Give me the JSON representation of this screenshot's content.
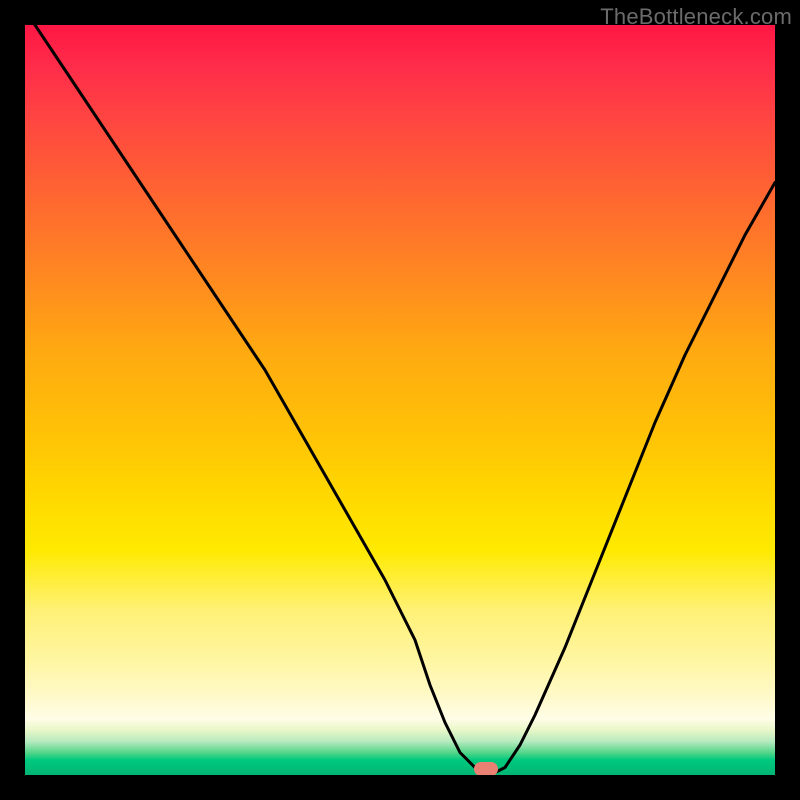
{
  "watermark": "TheBottleneck.com",
  "chart_data": {
    "type": "line",
    "title": "",
    "xlabel": "",
    "ylabel": "",
    "xlim": [
      0,
      100
    ],
    "ylim": [
      0,
      100
    ],
    "x": [
      0,
      4,
      8,
      12,
      16,
      20,
      24,
      28,
      32,
      36,
      40,
      44,
      48,
      52,
      54,
      56,
      58,
      60,
      61,
      62,
      64,
      66,
      68,
      72,
      76,
      80,
      84,
      88,
      92,
      96,
      100
    ],
    "values": [
      102,
      96,
      90,
      84,
      78,
      72,
      66,
      60,
      54,
      47,
      40,
      33,
      26,
      18,
      12,
      7,
      3,
      1,
      0,
      0,
      1,
      4,
      8,
      17,
      27,
      37,
      47,
      56,
      64,
      72,
      79
    ],
    "marker": {
      "x": 61.5,
      "y": 0
    },
    "gradient_stops": [
      {
        "pos": 0,
        "color": "#ff1744"
      },
      {
        "pos": 0.24,
        "color": "#ff6a2f"
      },
      {
        "pos": 0.54,
        "color": "#ffc107"
      },
      {
        "pos": 0.78,
        "color": "#fff176"
      },
      {
        "pos": 0.93,
        "color": "#fffde7"
      },
      {
        "pos": 1.0,
        "color": "#00b574"
      }
    ]
  }
}
